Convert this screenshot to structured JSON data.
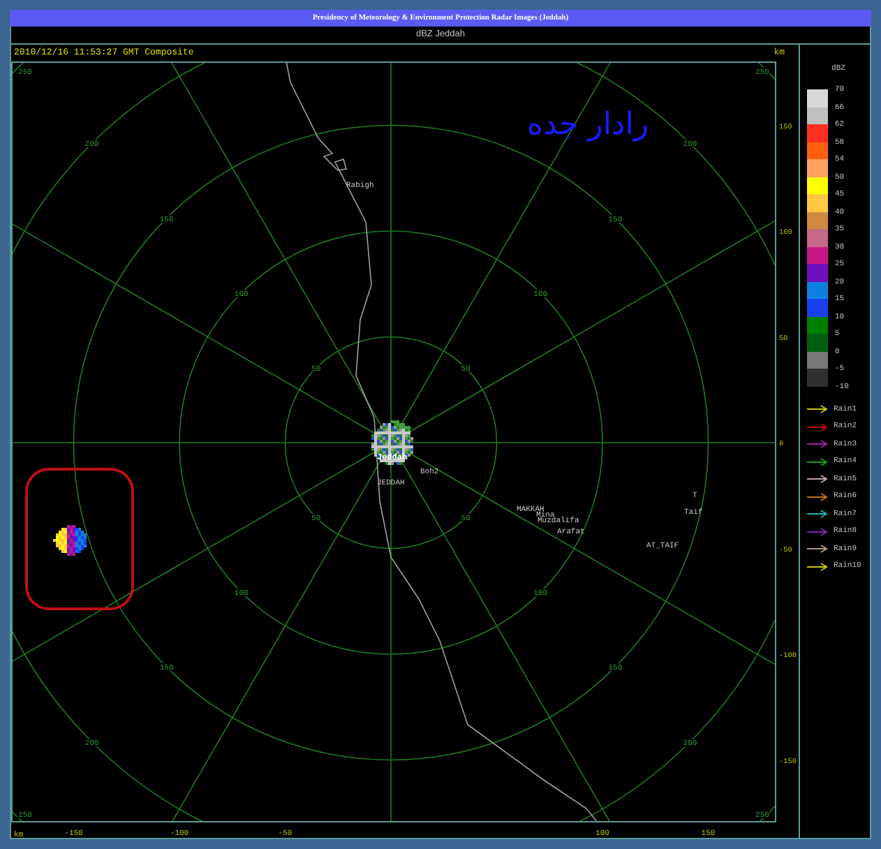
{
  "header": {
    "title": "Presidency of Meteorology & Environment Protection Radar Images (Jeddah)"
  },
  "product": {
    "title": "dBZ Jeddah"
  },
  "map": {
    "timestamp": "2010/12/16 11:53:27 GMT Composite",
    "unit_top": "km",
    "unit_bottom": "km",
    "caption": "رادار جده",
    "x_ticks": [
      "-150",
      "-100",
      "-50",
      "100",
      "150"
    ],
    "y_ticks": [
      "150",
      "100",
      "50",
      "0",
      "-50",
      "-100",
      "-150"
    ],
    "ring_label_sets": [
      {
        "labels": [
          "50",
          "100",
          "150",
          "200",
          "250"
        ]
      },
      {
        "labels": [
          "50",
          "100",
          "150",
          "200",
          "250"
        ]
      },
      {
        "labels": [
          "50",
          "100",
          "150",
          "200",
          "250"
        ]
      },
      {
        "labels": [
          "50",
          "100",
          "150",
          "200",
          "250"
        ]
      }
    ],
    "places": [
      {
        "name": "Rabigh",
        "kind": "town"
      },
      {
        "name": "Jeddah",
        "kind": "radar"
      },
      {
        "name": "Boh2",
        "kind": "town"
      },
      {
        "name": "JEDDAH",
        "kind": "town"
      },
      {
        "name": "MAKKAH",
        "kind": "town"
      },
      {
        "name": "Mina",
        "kind": "town"
      },
      {
        "name": "Muzdalifa",
        "kind": "town"
      },
      {
        "name": "Arafat",
        "kind": "town"
      },
      {
        "name": "T",
        "kind": "town"
      },
      {
        "name": "Taif",
        "kind": "town"
      },
      {
        "name": "AT_TAIF",
        "kind": "town"
      }
    ]
  },
  "legend": {
    "title": "dBZ",
    "end_label": "-10",
    "scale": [
      {
        "label": "70",
        "color": "#d8d8d8"
      },
      {
        "label": "66",
        "color": "#c0c0c0"
      },
      {
        "label": "62",
        "color": "#ff3020"
      },
      {
        "label": "58",
        "color": "#ff6010"
      },
      {
        "label": "54",
        "color": "#ffa060"
      },
      {
        "label": "50",
        "color": "#ffff00"
      },
      {
        "label": "45",
        "color": "#ffc840"
      },
      {
        "label": "40",
        "color": "#d08840"
      },
      {
        "label": "35",
        "color": "#c86888"
      },
      {
        "label": "30",
        "color": "#c81888"
      },
      {
        "label": "25",
        "color": "#7010c0"
      },
      {
        "label": "20",
        "color": "#1080e0"
      },
      {
        "label": "15",
        "color": "#1840f0"
      },
      {
        "label": "10",
        "color": "#008000"
      },
      {
        "label": "5",
        "color": "#006010"
      },
      {
        "label": "0",
        "color": "#787878"
      },
      {
        "label": "-5",
        "color": "#303030"
      }
    ],
    "tracks": [
      {
        "label": "Rain1",
        "color": "#c8c800"
      },
      {
        "label": "Rain2",
        "color": "#c00000"
      },
      {
        "label": "Rain3",
        "color": "#a020a0"
      },
      {
        "label": "Rain4",
        "color": "#10a010"
      },
      {
        "label": "Rain5",
        "color": "#c0a0b0"
      },
      {
        "label": "Rain6",
        "color": "#c07010"
      },
      {
        "label": "Rain7",
        "color": "#20b0b0"
      },
      {
        "label": "Rain8",
        "color": "#8020b0"
      },
      {
        "label": "Rain9",
        "color": "#b09880"
      },
      {
        "label": "Rain10",
        "color": "#c8c800"
      }
    ]
  }
}
